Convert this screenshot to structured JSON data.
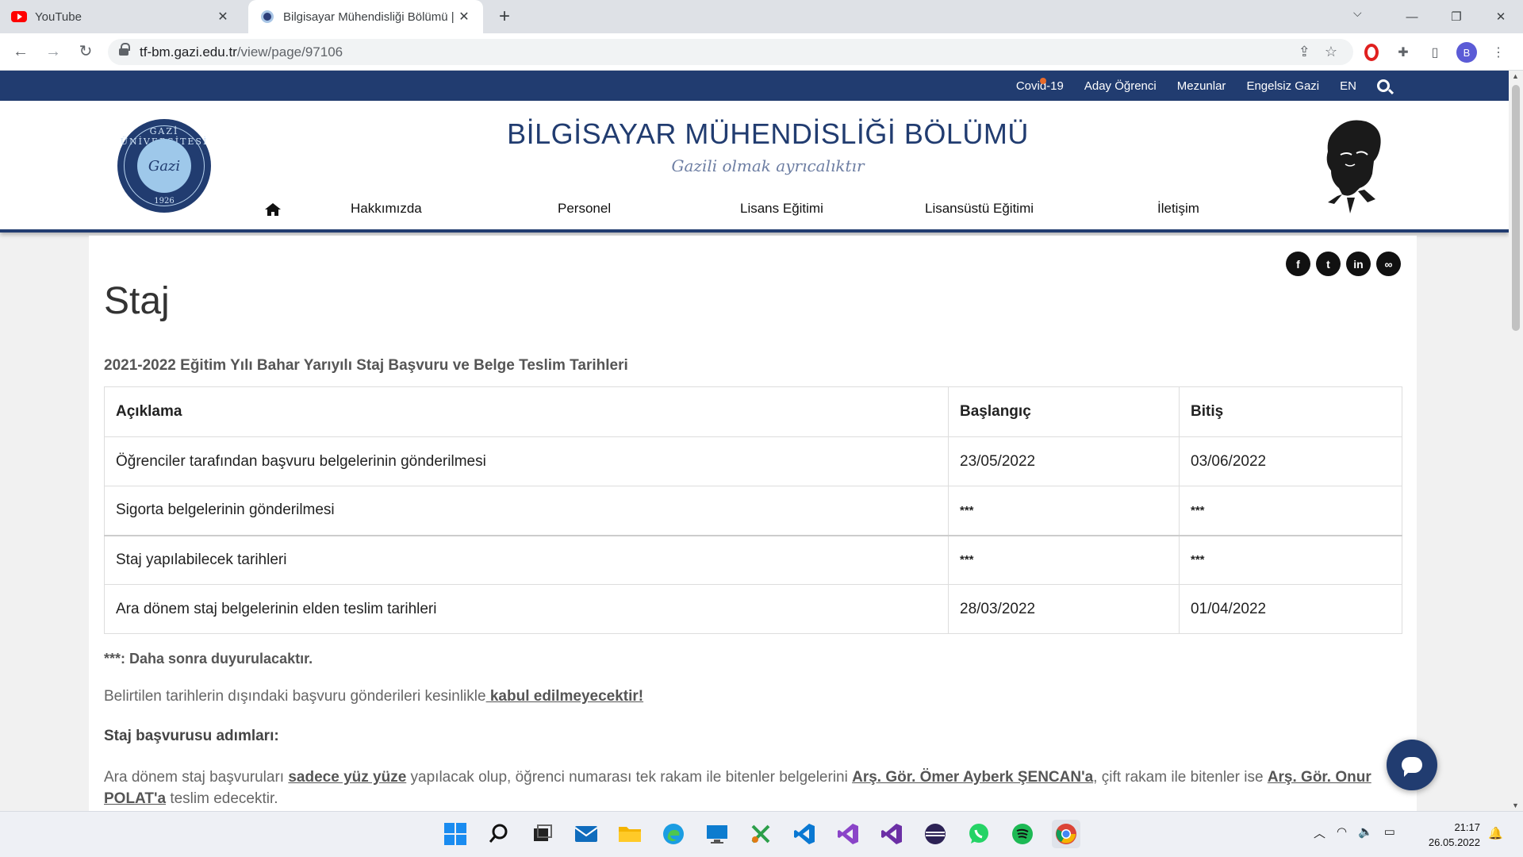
{
  "browser": {
    "tabs": [
      {
        "title": "YouTube",
        "active": false
      },
      {
        "title": "Bilgisayar Mühendisliği Bölümü |",
        "active": true
      }
    ],
    "url_host": "tf-bm.gazi.edu.tr",
    "url_path": "/view/page/97106",
    "profile_initial": "B"
  },
  "site": {
    "topbar_links": [
      "Covid-19",
      "Aday Öğrenci",
      "Mezunlar",
      "Engelsiz Gazi",
      "EN"
    ],
    "title": "BİLGİSAYAR MÜHENDİSLİĞİ BÖLÜMÜ",
    "slogan": "Gazili olmak ayrıcalıktır",
    "logo": {
      "arc_text": "GAZİ ÜNİVERSİTESİ",
      "center_text": "Gazi",
      "year": "1926"
    },
    "nav": [
      "Hakkımızda",
      "Personel",
      "Lisans Eğitimi",
      "Lisansüstü Eğitimi",
      "İletişim"
    ]
  },
  "page": {
    "title": "Staj",
    "subheading": "2021-2022 Eğitim Yılı Bahar Yarıyılı Staj Başvuru ve Belge Teslim Tarihleri",
    "table": {
      "headers": [
        "Açıklama",
        "Başlangıç",
        "Bitiş"
      ],
      "rows": [
        [
          "Öğrenciler tarafından başvuru belgelerinin gönderilmesi",
          "23/05/2022",
          "03/06/2022"
        ],
        [
          "Sigorta belgelerinin gönderilmesi",
          "***",
          "***"
        ],
        [
          "Staj yapılabilecek tarihleri",
          "***",
          "***"
        ],
        [
          "Ara dönem staj belgelerinin elden teslim tarihleri",
          "28/03/2022",
          "01/04/2022"
        ]
      ]
    },
    "note": "***: Daha sonra duyurulacaktır.",
    "warning_text": "Belirtilen tarihlerin dışındaki başvuru gönderileri kesinlikle",
    "warning_link": " kabul edilmeyecektir!",
    "steps_heading": "Staj başvurusu adımları:",
    "para": {
      "t1": "Ara dönem staj başvuruları ",
      "l1": "sadece yüz yüze",
      "t2": " yapılacak olup, öğrenci numarası tek rakam ile bitenler belgelerini  ",
      "l2": "Arş. Gör. Ömer Ayberk ŞENCAN'a",
      "t3": ", çift rakam ile bitenler ise ",
      "l3": "Arş. Gör. Onur POLAT'a",
      "t4": " teslim edecektir."
    }
  },
  "taskbar": {
    "time": "21:17",
    "date": "26.05.2022"
  }
}
